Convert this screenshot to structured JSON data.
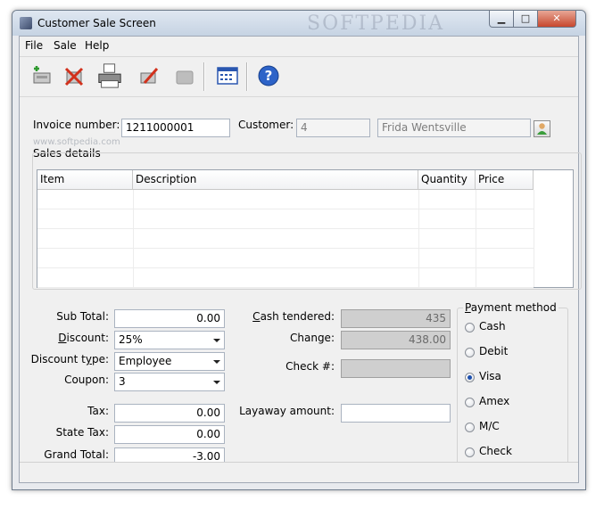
{
  "window": {
    "title": "Customer Sale Screen",
    "watermark": "SOFTPEDIA"
  },
  "menu": [
    "File",
    "Sale",
    "Help"
  ],
  "toolbar": {
    "icons": [
      "new-sale-icon",
      "delete-icon",
      "print-icon",
      "edit-icon",
      "disabled-icon",
      "calendar-icon",
      "help-icon"
    ]
  },
  "header": {
    "invoice_label": "Invoice number:",
    "invoice_value": "1211000001",
    "customer_label": "Customer:",
    "customer_id": "4",
    "customer_name": "Frida Wentsville",
    "watermark_small": "www.softpedia.com"
  },
  "sales": {
    "label": "Sales details",
    "columns": [
      "Item",
      "Description",
      "Quantity",
      "Price"
    ]
  },
  "totals": {
    "subtotal_label": "Sub Total:",
    "subtotal": "0.00",
    "discount_label_pre": "",
    "discount_label_k": "D",
    "discount_label_post": "iscount:",
    "discount": "25%",
    "discount_type_label_pre": "Discount t",
    "discount_type_label_k": "y",
    "discount_type_label_post": "pe:",
    "discount_type": "Employee",
    "coupon_label": "Coupon:",
    "coupon": "3",
    "tax_label": "Tax:",
    "tax": "0.00",
    "state_tax_label": "State Tax:",
    "state_tax": "0.00",
    "grand_total_label": "Grand Total:",
    "grand_total": "-3.00"
  },
  "cash": {
    "tendered_label_k": "C",
    "tendered_label_post": "ash tendered:",
    "tendered": "435",
    "change_label": "Change:",
    "change": "438.00",
    "check_label": "Check #:",
    "check": "",
    "layaway_label": "Layaway amount:",
    "layaway": ""
  },
  "payment": {
    "legend_k": "P",
    "legend_post": "ayment method",
    "options": [
      "Cash",
      "Debit",
      "Visa",
      "Amex",
      "M/C",
      "Check"
    ],
    "selected": "Visa"
  }
}
